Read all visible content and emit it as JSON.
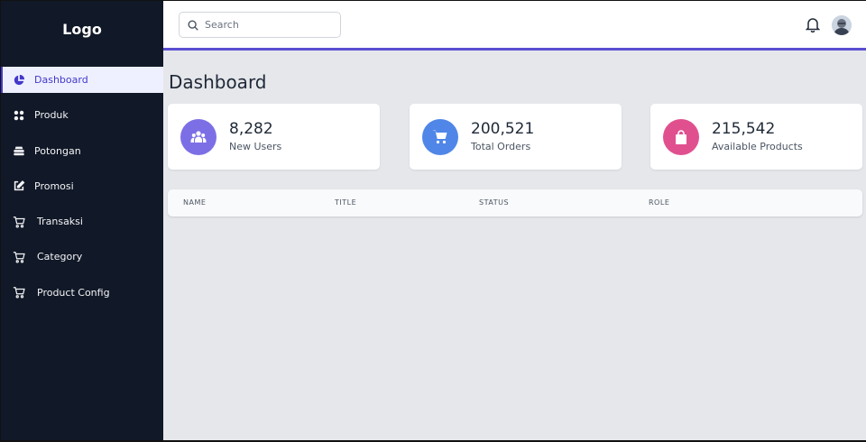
{
  "sidebar": {
    "logo": "Logo",
    "items": [
      {
        "label": "Dashboard",
        "icon": "pie-chart-icon",
        "active": true
      },
      {
        "label": "Produk",
        "icon": "grid-icon"
      },
      {
        "label": "Potongan",
        "icon": "layers-icon"
      },
      {
        "label": "Promosi",
        "icon": "edit-icon"
      },
      {
        "label": "Transaksi",
        "icon": "cart-icon"
      },
      {
        "label": "Category",
        "icon": "cart-icon"
      },
      {
        "label": "Product Config",
        "icon": "cart-icon"
      }
    ]
  },
  "header": {
    "search_placeholder": "Search",
    "accent": "#5b4ed1"
  },
  "main": {
    "title": "Dashboard",
    "stats": [
      {
        "value": "8,282",
        "label": "New Users",
        "color": "#7c6fe6",
        "icon": "users-icon"
      },
      {
        "value": "200,521",
        "label": "Total Orders",
        "color": "#4f86e8",
        "icon": "cart-icon"
      },
      {
        "value": "215,542",
        "label": "Available Products",
        "color": "#e0508f",
        "icon": "shopping-bag-icon"
      }
    ],
    "table": {
      "columns": [
        "NAME",
        "TITLE",
        "STATUS",
        "ROLE"
      ]
    }
  }
}
